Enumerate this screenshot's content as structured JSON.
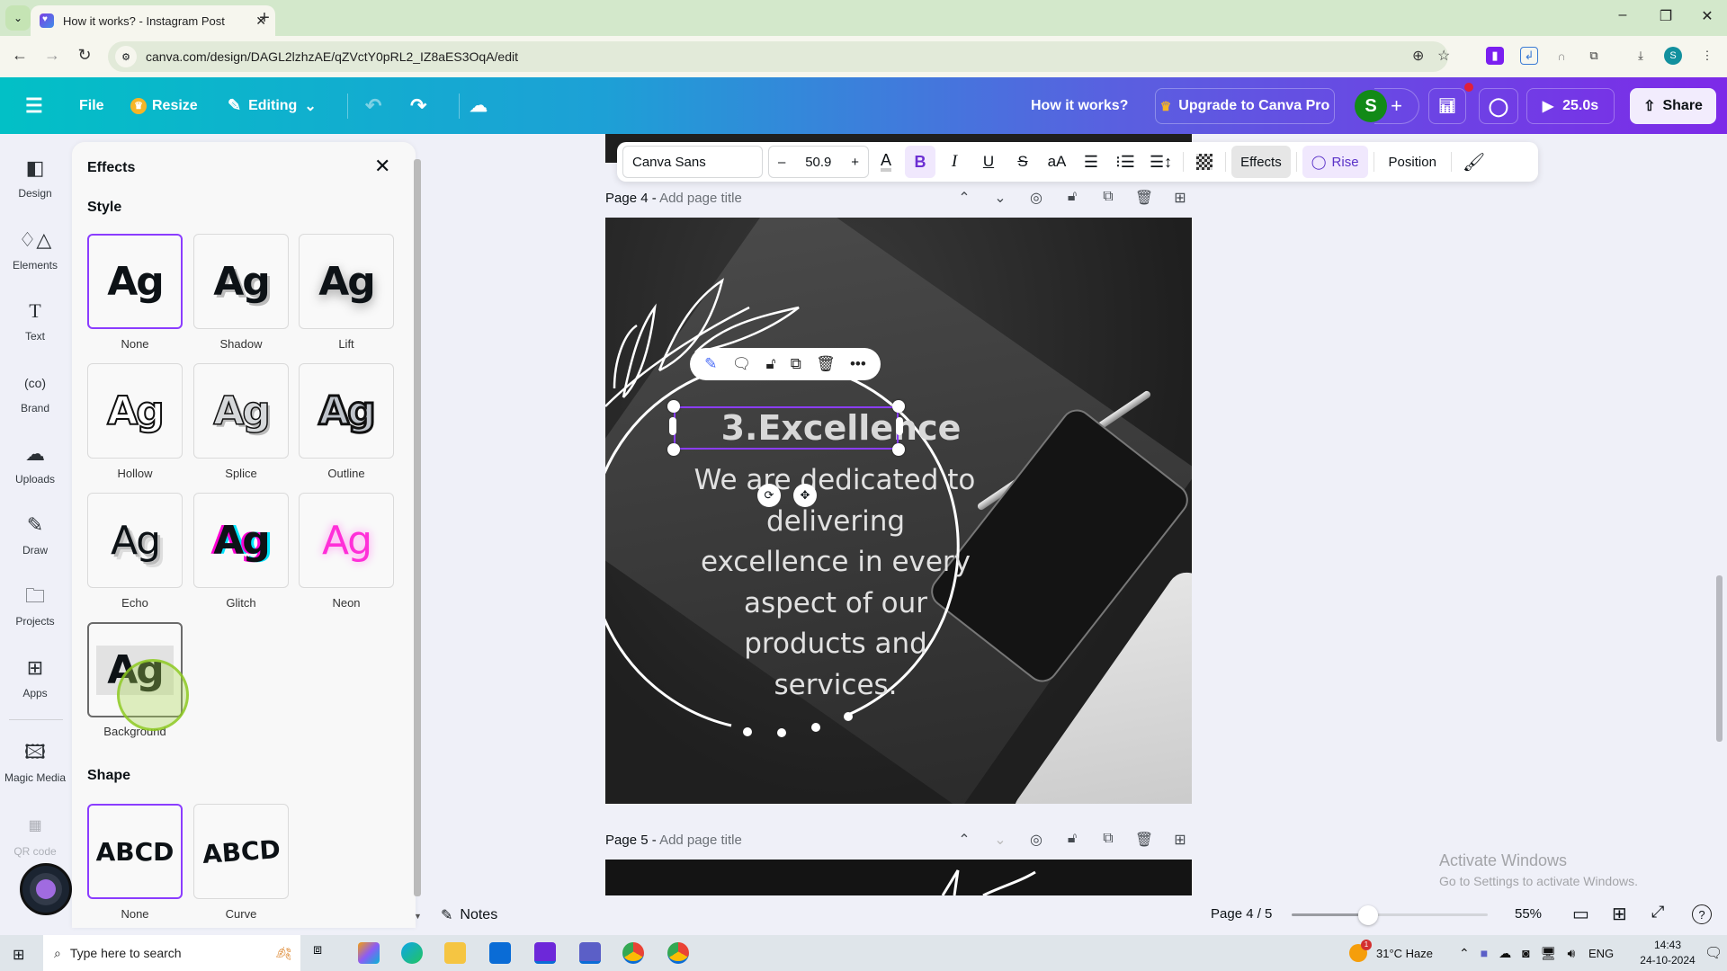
{
  "browser": {
    "tab_title": "How it works? - Instagram Post",
    "url": "canva.com/design/DAGL2lzhzAE/qZVctY0pRL2_IZ8aES3OqA/edit",
    "profile_initial": "S"
  },
  "header": {
    "file_label": "File",
    "resize_label": "Resize",
    "editing_label": "Editing",
    "design_title": "How it works?",
    "upgrade_label": "Upgrade to Canva Pro",
    "user_initial": "S",
    "play_label": "25.0s",
    "share_label": "Share"
  },
  "rail": {
    "items": [
      {
        "label": "Design",
        "icon": "design-icon"
      },
      {
        "label": "Elements",
        "icon": "elements-icon"
      },
      {
        "label": "Text",
        "icon": "text-icon"
      },
      {
        "label": "Brand",
        "icon": "brand-icon"
      },
      {
        "label": "Uploads",
        "icon": "upload-cloud-icon"
      },
      {
        "label": "Draw",
        "icon": "draw-icon"
      },
      {
        "label": "Projects",
        "icon": "folder-icon"
      },
      {
        "label": "Apps",
        "icon": "apps-icon"
      },
      {
        "label": "Magic Media",
        "icon": "magic-media-icon"
      },
      {
        "label": "QR code",
        "icon": "qr-code-icon"
      }
    ]
  },
  "effects_panel": {
    "title": "Effects",
    "style_heading": "Style",
    "styles": [
      {
        "label": "None",
        "sample": "Ag",
        "selected": true
      },
      {
        "label": "Shadow",
        "sample": "Ag",
        "selected": false
      },
      {
        "label": "Lift",
        "sample": "Ag",
        "selected": false
      },
      {
        "label": "Hollow",
        "sample": "Ag",
        "selected": false
      },
      {
        "label": "Splice",
        "sample": "Ag",
        "selected": false
      },
      {
        "label": "Outline",
        "sample": "Ag",
        "selected": false
      },
      {
        "label": "Echo",
        "sample": "Ag",
        "selected": false
      },
      {
        "label": "Glitch",
        "sample": "Ag",
        "selected": false
      },
      {
        "label": "Neon",
        "sample": "Ag",
        "selected": false
      },
      {
        "label": "Background",
        "sample": "Ag",
        "selected": false
      }
    ],
    "shape_heading": "Shape",
    "shapes": [
      {
        "label": "None",
        "sample": "ABCD",
        "selected": true
      },
      {
        "label": "Curve",
        "sample": "ABCD",
        "selected": false
      }
    ]
  },
  "text_toolbar": {
    "font": "Canva Sans",
    "font_size": "50.9",
    "minus": "–",
    "plus": "+",
    "bold": "B",
    "italic": "I",
    "underline": "U",
    "strike": "S",
    "case": "aA",
    "effects_label": "Effects",
    "animate_label": "Rise",
    "position_label": "Position"
  },
  "pages": [
    {
      "label": "Page 4 -",
      "title_placeholder": "Add page title"
    },
    {
      "label": "Page 5 -",
      "title_placeholder": "Add page title"
    }
  ],
  "canvas": {
    "heading": "3.Excellence",
    "body_lines": [
      "We are dedicated to",
      "delivering",
      "excellence in every",
      "aspect of our",
      "products and",
      "services."
    ]
  },
  "bottom": {
    "notes_label": "Notes",
    "page_indicator": "Page 4 / 5",
    "zoom_value": 55,
    "zoom_label": "55%"
  },
  "watermark": {
    "line1": "Activate Windows",
    "line2": "Go to Settings to activate Windows."
  },
  "taskbar": {
    "search_placeholder": "Type here to search",
    "weather": "31°C  Haze",
    "weather_badge": "1",
    "lang": "ENG",
    "time": "14:43",
    "date": "24-10-2024"
  },
  "colors": {
    "accent": "#8b3dff",
    "header_start": "#02c0c6",
    "header_end": "#7d2ae8",
    "avatar_green": "#128a17"
  }
}
